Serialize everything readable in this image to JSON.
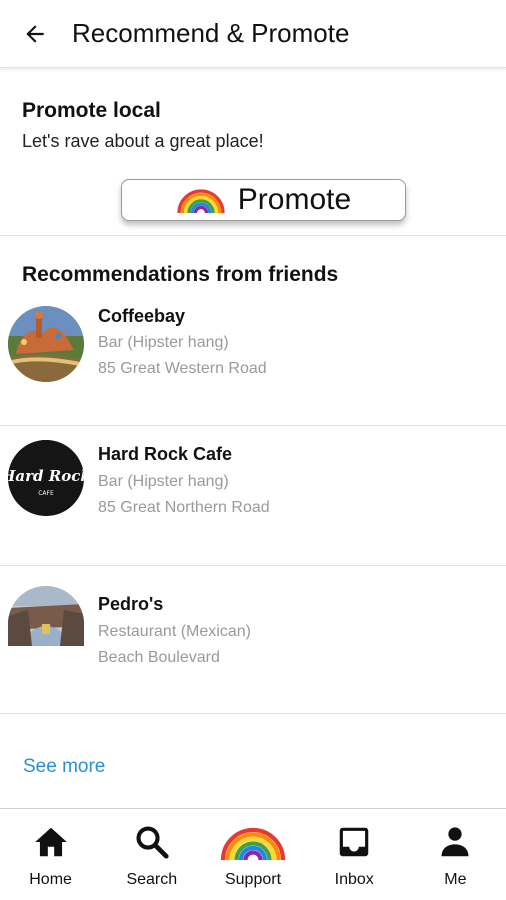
{
  "appbar": {
    "title": "Recommend & Promote",
    "back_icon": "arrow-left-icon"
  },
  "promote": {
    "title": "Promote local",
    "subtitle": "Let's rave about a great place!",
    "button_label": "Promote",
    "button_icon": "rainbow-icon"
  },
  "recommendations": {
    "header": "Recommendations from friends",
    "items": [
      {
        "name": "Coffeebay",
        "category": "Bar (Hipster hang)",
        "address": "85  Great Western Road",
        "thumb": "mosaic-building-photo"
      },
      {
        "name": "Hard Rock Cafe",
        "category": "Bar (Hipster hang)",
        "address": "85  Great Northern Road",
        "thumb": "hard-rock-cafe-logo",
        "logo_text": "Hard Rock",
        "logo_sub": "CAFE"
      },
      {
        "name": "Pedro's",
        "category": "Restaurant (Mexican)",
        "address": "Beach Boulevard",
        "thumb": "tower-photo"
      }
    ],
    "see_more": "See more"
  },
  "nav": {
    "items": [
      {
        "label": "Home",
        "icon": "home-icon"
      },
      {
        "label": "Search",
        "icon": "search-icon"
      },
      {
        "label": "Support",
        "icon": "rainbow-icon"
      },
      {
        "label": "Inbox",
        "icon": "inbox-icon"
      },
      {
        "label": "Me",
        "icon": "person-icon"
      }
    ]
  },
  "colors": {
    "link": "#2a8fd6",
    "muted_text": "#9a9a9a",
    "divider": "#e4e4e4"
  }
}
